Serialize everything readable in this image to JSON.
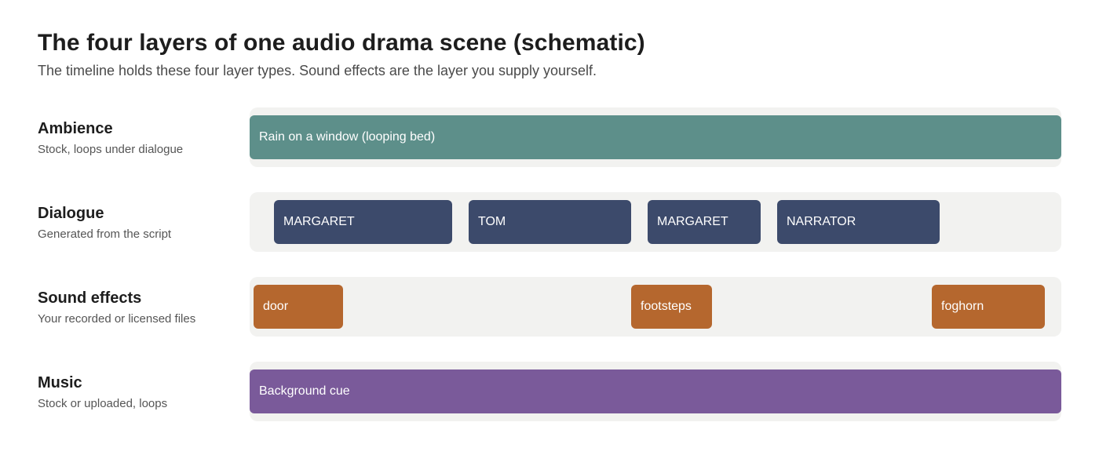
{
  "title": "The four layers of one audio drama scene (schematic)",
  "subtitle": "The timeline holds these four layer types. Sound effects are the layer you supply yourself.",
  "colors": {
    "ambience": "#5d8f8a",
    "dialogue": "#3c4a6b",
    "sound_effects": "#b5672e",
    "music": "#7a5a9a",
    "track_background": "#f2f2f0"
  },
  "layers": [
    {
      "name": "Ambience",
      "description": "Stock, loops under dialogue",
      "clips": [
        {
          "label": "Rain on a window (looping bed)"
        }
      ]
    },
    {
      "name": "Dialogue",
      "description": "Generated from the script",
      "clips": [
        {
          "label": "MARGARET"
        },
        {
          "label": "TOM"
        },
        {
          "label": "MARGARET"
        },
        {
          "label": "NARRATOR"
        }
      ]
    },
    {
      "name": "Sound effects",
      "description": "Your recorded or licensed files",
      "clips": [
        {
          "label": "door"
        },
        {
          "label": "footsteps"
        },
        {
          "label": "foghorn"
        }
      ]
    },
    {
      "name": "Music",
      "description": "Stock or uploaded, loops",
      "clips": [
        {
          "label": "Background cue"
        }
      ]
    }
  ]
}
